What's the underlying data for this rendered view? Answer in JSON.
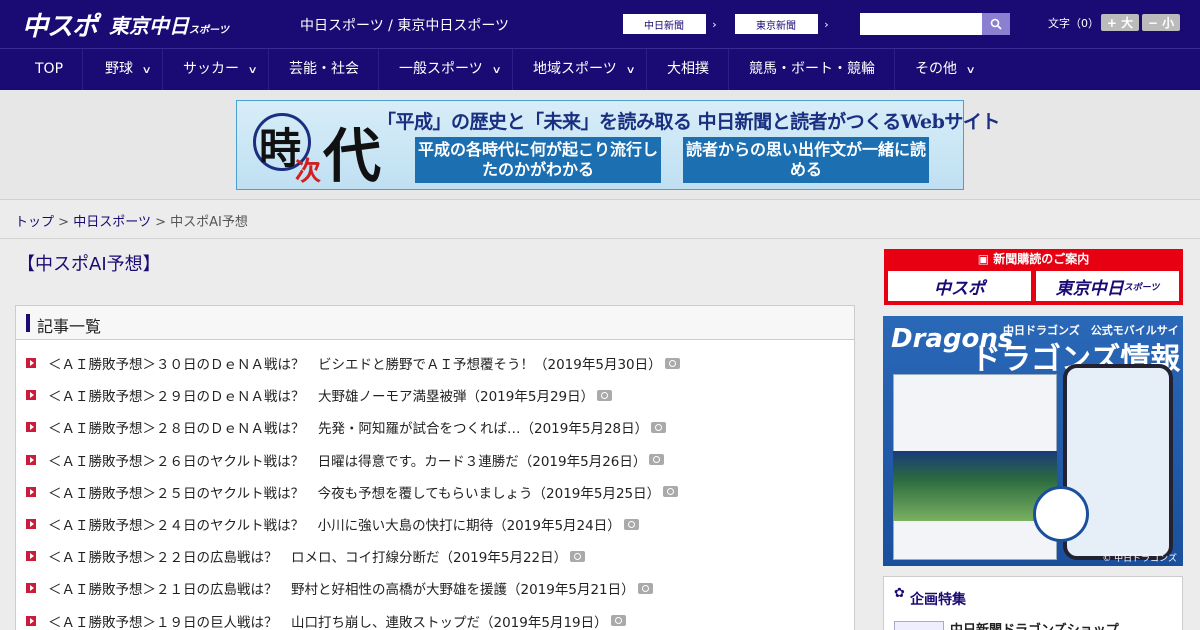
{
  "header": {
    "logo_chuspo": "中スポ",
    "logo_tokyo": "東京中日",
    "logo_tokyo_suffix": "スポーツ",
    "site_title": "中日スポーツ / 東京中日スポーツ",
    "paper_buttons": [
      {
        "label": "中日新聞"
      },
      {
        "label": "東京新聞"
      }
    ],
    "search_placeholder": "",
    "font_label": "文字（0）",
    "font_large": "+ 大",
    "font_small": "− 小"
  },
  "nav": {
    "items": [
      {
        "label": "TOP",
        "has_menu": false
      },
      {
        "label": "野球",
        "has_menu": true
      },
      {
        "label": "サッカー",
        "has_menu": true
      },
      {
        "label": "芸能・社会",
        "has_menu": false
      },
      {
        "label": "一般スポーツ",
        "has_menu": true
      },
      {
        "label": "地域スポーツ",
        "has_menu": true
      },
      {
        "label": "大相撲",
        "has_menu": false
      },
      {
        "label": "競馬・ボート・競輪",
        "has_menu": false
      },
      {
        "label": "その他",
        "has_menu": true
      }
    ]
  },
  "banner": {
    "logo_ji": "時",
    "logo_tsugi": "次",
    "logo_dai": "代",
    "headline": "「平成」の歴史と「未来」を読み取る 中日新聞と読者がつくるWebサイト",
    "box_left": "平成の各時代に何が起こり流行したのかがわかる",
    "box_right": "読者からの思い出作文が一緒に読める"
  },
  "breadcrumb": {
    "top": "トップ",
    "section": "中日スポーツ",
    "current": "中スポAI予想",
    "sep": ">"
  },
  "page_title": "【中スポAI予想】",
  "articles": {
    "heading": "記事一覧",
    "items": [
      "＜ＡＩ勝敗予想＞３０日のＤｅＮＡ戦は？　ビシエドと勝野でＡＩ予想覆そう！（2019年5月30日）",
      "＜ＡＩ勝敗予想＞２９日のＤｅＮＡ戦は？　大野雄ノーモア満塁被弾（2019年5月29日）",
      "＜ＡＩ勝敗予想＞２８日のＤｅＮＡ戦は？　先発・阿知羅が試合をつくれば…（2019年5月28日）",
      "＜ＡＩ勝敗予想＞２６日のヤクルト戦は？　日曜は得意です。カード３連勝だ（2019年5月26日）",
      "＜ＡＩ勝敗予想＞２５日のヤクルト戦は？　今夜も予想を覆してもらいましょう（2019年5月25日）",
      "＜ＡＩ勝敗予想＞２４日のヤクルト戦は？　小川に強い大島の快打に期待（2019年5月24日）",
      "＜ＡＩ勝敗予想＞２２日の広島戦は？　ロメロ、コイ打線分断だ（2019年5月22日）",
      "＜ＡＩ勝敗予想＞２１日の広島戦は？　野村と好相性の高橋が大野雄を援護（2019年5月21日）",
      "＜ＡＩ勝敗予想＞１９日の巨人戦は？　山口打ち崩し、連敗ストップだ（2019年5月19日）"
    ]
  },
  "sidebar": {
    "subscribe_title": "新聞購読のご案内",
    "subscribe_cards": [
      "中スポ",
      "東京中日"
    ],
    "subscribe_card_suffix": "スポーツ",
    "dragons": {
      "logo": "Dragons",
      "subtitle": "中日ドラゴンズ　公式モバイルサイト",
      "title": "ドラゴンズ情報",
      "copyright": "© 中日ドラゴンズ"
    },
    "feature_title": "企画特集",
    "feature_item": "中日新聞ドラゴンズショップ"
  },
  "colors": {
    "brand_navy": "#1a0a73",
    "accent_red": "#cc1a3a",
    "subscribe_red": "#e60012"
  }
}
